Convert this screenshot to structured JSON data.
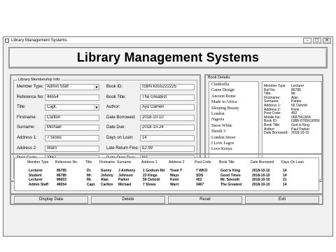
{
  "window": {
    "title": "Library Management Systems",
    "controls": [
      "–",
      "□",
      "✕"
    ]
  },
  "banner": {
    "title": "Library Management Systems"
  },
  "membership": {
    "legend": "Library Membership Info:",
    "left": [
      {
        "label": "Member Type:",
        "value": "Admin Staff",
        "dropdown": true
      },
      {
        "label": "Reference No:",
        "value": "46554",
        "dropdown": false
      },
      {
        "label": "Title:",
        "value": "Capt.",
        "dropdown": true
      },
      {
        "label": "Firstname:",
        "value": "Carlton",
        "dropdown": false
      },
      {
        "label": "Surname:",
        "value": "Michael",
        "dropdown": false
      },
      {
        "label": "Address 1:",
        "value": "7 Slows",
        "dropdown": false
      },
      {
        "label": "Address 2:",
        "value": "Warri",
        "dropdown": false
      },
      {
        "label": "Post Code:",
        "value": "3467",
        "dropdown": false
      },
      {
        "label": "Mobile No:",
        "value": "0235895655",
        "dropdown": false
      }
    ],
    "right": [
      {
        "label": "Book ID:",
        "value": "ISBN 6355222225",
        "dropdown": false
      },
      {
        "label": "Book Title:",
        "value": "The Greatest",
        "dropdown": false
      },
      {
        "label": "Author:",
        "value": "Ayo Oamen",
        "dropdown": false
      },
      {
        "label": "Date Borrowed:",
        "value": "2018-10-10",
        "dropdown": false
      },
      {
        "label": "Date Due:",
        "value": "2018-10-24",
        "dropdown": false
      },
      {
        "label": "Days on Loan:",
        "value": "14",
        "dropdown": false
      },
      {
        "label": "Late Return Fine:",
        "value": "£2.99",
        "dropdown": false
      },
      {
        "label": "Date Over Due:",
        "value": "No",
        "dropdown": false
      },
      {
        "label": "Selling Price:",
        "value": "£13.45",
        "dropdown": false
      }
    ]
  },
  "books": {
    "legend": "Book Details:",
    "list": [
      "Cinderella",
      "Game Design",
      "Ancient Rome",
      "Made in Africa",
      "Sleeping Beauty",
      "London",
      "Nigeria",
      "Snow White",
      "Shreik 3",
      "London Street",
      "I Love Lagos",
      "Love Kenya"
    ],
    "details": [
      {
        "k": "Member Type:",
        "v": "Lecturer"
      },
      {
        "k": "Ref No:",
        "v": "86785"
      },
      {
        "k": "Title:",
        "v": "Mr."
      },
      {
        "k": "Firstname:",
        "v": "Alan"
      },
      {
        "k": "Surname:",
        "v": "Parker"
      },
      {
        "k": "Address 1:",
        "v": "56 Oshodi"
      },
      {
        "k": "Address 2:",
        "v": "Kemi"
      },
      {
        "k": "Post Code:",
        "v": "452"
      },
      {
        "k": "Mobile No:",
        "v": "0687561564"
      },
      {
        "k": "Book ID:",
        "v": "ISBN 8765616556"
      },
      {
        "k": "Book Title:",
        "v": "God is King"
      },
      {
        "k": "Author:",
        "v": "Paul Parker"
      },
      {
        "k": "Date Borrowed:",
        "v": "2018-10-10"
      }
    ]
  },
  "table": {
    "headers": [
      "Member Type",
      "Reference No.",
      "Title",
      "Firstname",
      "Surname",
      "Address 1",
      "Address 2",
      "Post Code",
      "Book Title",
      "Date Borrowed",
      "Days On Loan"
    ],
    "rows": [
      [
        "Lecturer",
        "86785",
        "Dr.",
        "Sunny",
        "J Anthony",
        "1 Godson Rd",
        "Town T",
        "7 WKO",
        "God is King",
        "2018-10-10",
        "14"
      ],
      [
        "Student",
        "86785",
        "Mr.",
        "Johnny",
        "Johnson",
        "23 Kings",
        "Ways",
        "SDS",
        "Good Times",
        "2018-10-10",
        "14"
      ],
      [
        "Lecturer",
        "86653",
        "Mr.",
        "Alan",
        "Parker",
        "56 Oshodi",
        "Kemi",
        "452",
        "Mr. Smooth",
        "2018-10-10",
        "21"
      ],
      [
        "Admin Staff",
        "46554",
        "Capt.",
        "Carlton",
        "Michael",
        "7 Slows",
        "Warri",
        "3467",
        "The Greatest",
        "2018-10-10",
        "14"
      ]
    ]
  },
  "buttons": {
    "display": "Display Data",
    "delete": "Delete",
    "reset": "Reset",
    "exit": "Exit"
  }
}
